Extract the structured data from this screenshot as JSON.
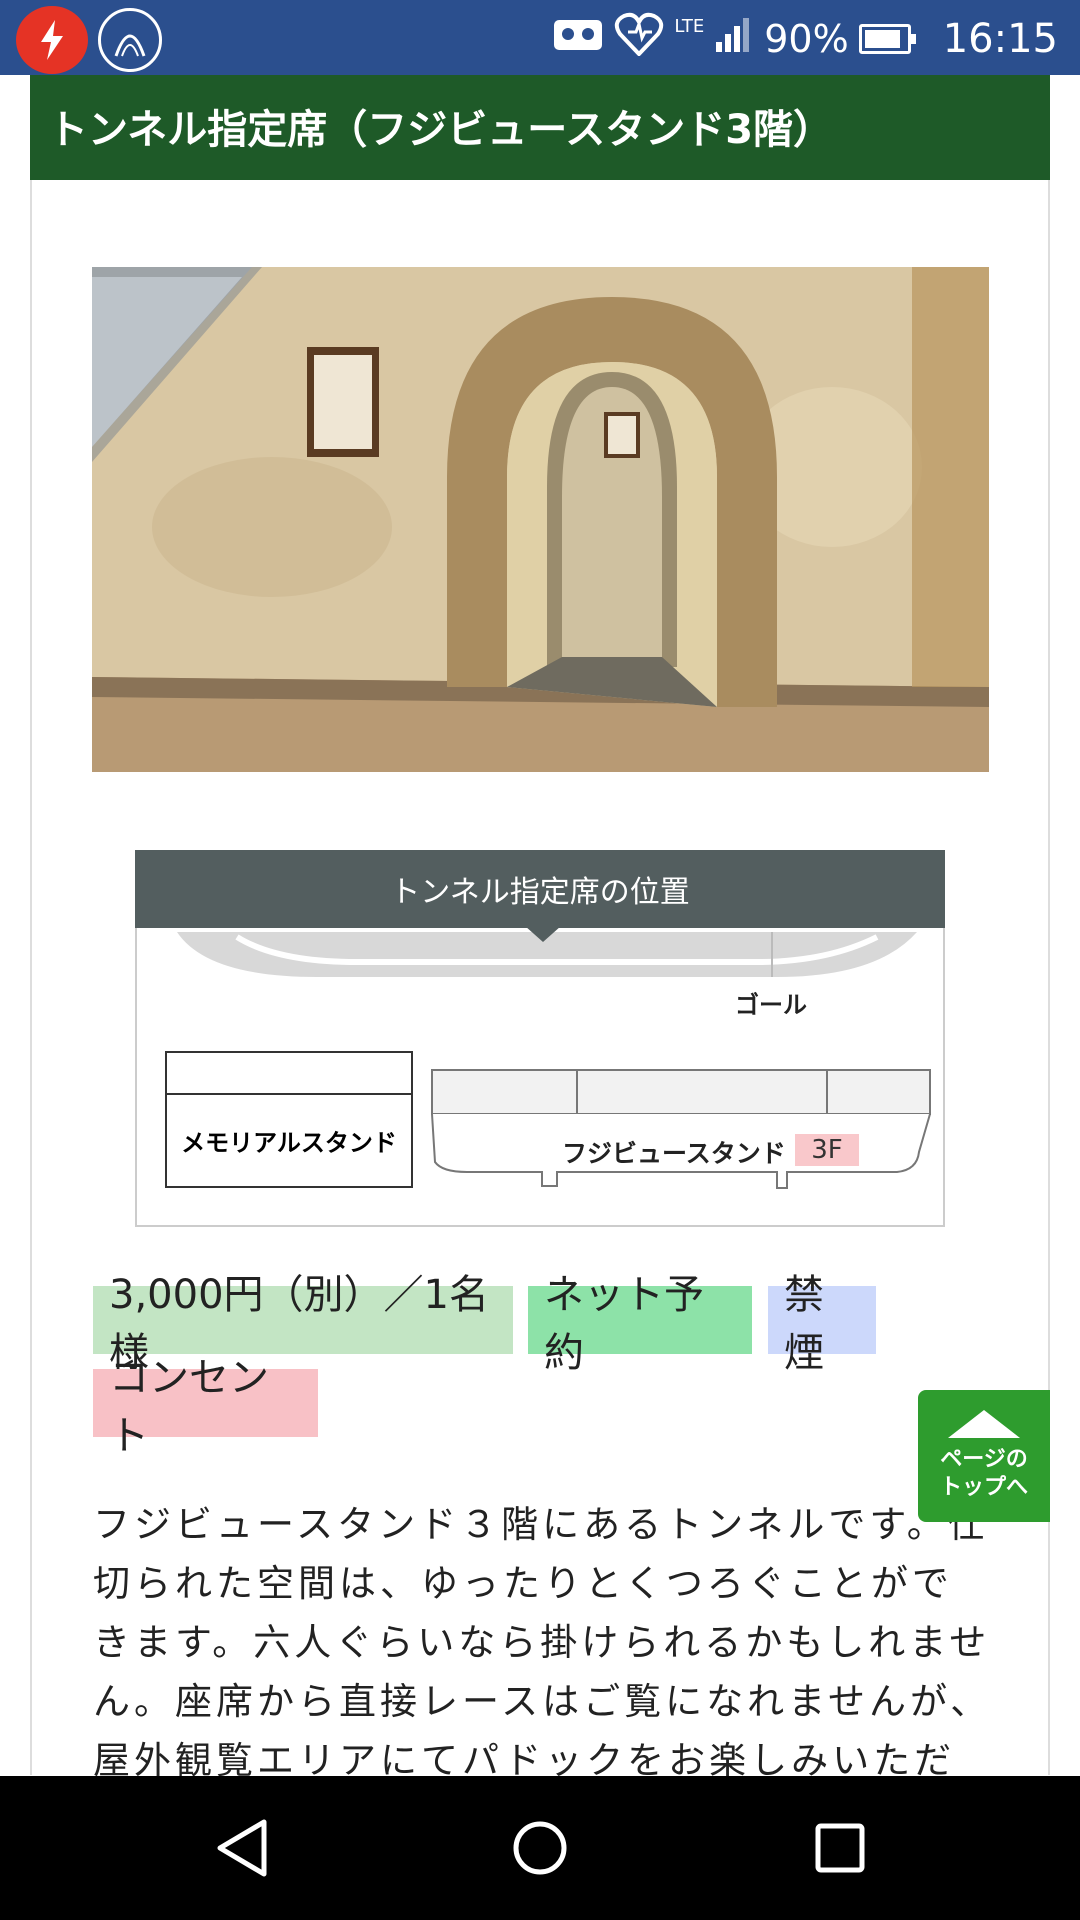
{
  "status_bar": {
    "network": "LTE",
    "battery": "90%",
    "time": "16:15"
  },
  "section": {
    "title": "トンネル指定席（フジビュースタンド3階）"
  },
  "map": {
    "title": "トンネル指定席の位置",
    "goal_label": "ゴール",
    "memorial_label": "メモリアルスタンド",
    "fuji_label": "フジビュースタンド",
    "floor_label": "3F"
  },
  "tags": {
    "price": "3,000円（別）／1名様",
    "net": "ネット予約",
    "smoke": "禁煙",
    "outlet": "コンセント"
  },
  "description": "フジビュースタンド３階にあるトンネルです。仕切られた空間は、ゆったりとくつろぐことができます。六人ぐらいなら掛けられるかもしれません。座席から直接レースはご覧になれませんが、屋外観覧エリアにてパドックをお楽しみいただけます。コンセント",
  "page_top": {
    "line1": "ページの",
    "line2": "トップへ"
  },
  "colors": {
    "status_bar": "#2b4f8e",
    "header_green": "#1e5a28",
    "map_title_bg": "#535e5f",
    "page_top_green": "#2e9c2e"
  },
  "icons": [
    "lightning-icon",
    "arc-app-icon",
    "vr-icon",
    "heart-icon",
    "signal-icon",
    "battery-icon",
    "back-icon",
    "home-icon",
    "recents-icon"
  ]
}
